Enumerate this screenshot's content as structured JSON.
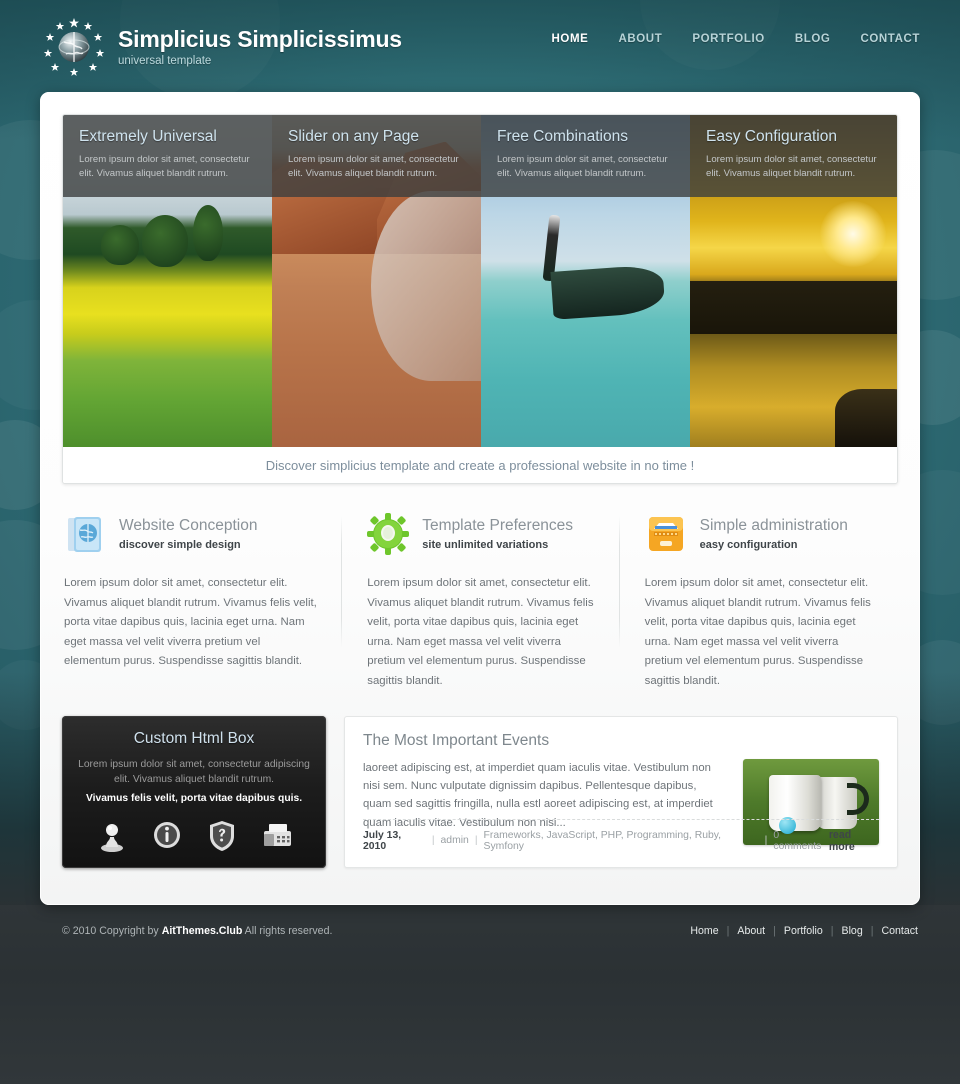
{
  "header": {
    "brand_title": "Simplicius Simplicissimus",
    "brand_subtitle": "universal template",
    "logo_icon": "globe-stars-icon",
    "nav": [
      {
        "label": "HOME",
        "active": true
      },
      {
        "label": "ABOUT",
        "active": false
      },
      {
        "label": "PORTFOLIO",
        "active": false
      },
      {
        "label": "BLOG",
        "active": false
      },
      {
        "label": "CONTACT",
        "active": false
      }
    ]
  },
  "slider": {
    "slides": [
      {
        "title": "Extremely Universal",
        "text": "Lorem ipsum dolor sit amet, consectetur elit. Vivamus aliquet blandit rutrum.",
        "image": "green-rapeseed-field-with-trees"
      },
      {
        "title": "Slider on any Page",
        "text": "Lorem ipsum dolor sit amet, consectetur elit. Vivamus aliquet blandit rutrum.",
        "image": "red-sandstone-cliff-beach"
      },
      {
        "title": "Free Combinations",
        "text": "Lorem ipsum dolor sit amet, consectetur elit. Vivamus aliquet blandit rutrum.",
        "image": "longtail-boat-turquoise-sea"
      },
      {
        "title": "Easy Configuration",
        "text": "Lorem ipsum dolor sit amet, consectetur elit. Vivamus aliquet blandit rutrum.",
        "image": "golden-sunset-over-water"
      }
    ],
    "tagline": "Discover simplicius template and create a professional website in no time !"
  },
  "features": [
    {
      "icon": "blue-book-globe-icon",
      "title": "Website Conception",
      "subtitle": "discover simple design",
      "body": "Lorem ipsum dolor sit amet, consectetur elit. Vivamus aliquet blandit rutrum. Vivamus felis velit, porta vitae dapibus quis, lacinia eget urna. Nam eget massa vel velit viverra pretium vel elementum purus. Suspendisse sagittis blandit."
    },
    {
      "icon": "green-gear-icon",
      "title": "Template Preferences",
      "subtitle": "site unlimited variations",
      "body": "Lorem ipsum dolor sit amet, consectetur elit. Vivamus aliquet blandit rutrum. Vivamus felis velit, porta vitae dapibus quis, lacinia eget urna. Nam eget massa vel velit viverra pretium vel elementum purus. Suspendisse sagittis blandit."
    },
    {
      "icon": "orange-filebox-icon",
      "title": "Simple administration",
      "subtitle": "easy configuration",
      "body": "Lorem ipsum dolor sit amet, consectetur elit. Vivamus aliquet blandit rutrum. Vivamus felis velit, porta vitae dapibus quis, lacinia eget urna. Nam eget massa vel velit viverra pretium vel elementum purus. Suspendisse sagittis blandit."
    }
  ],
  "html_box": {
    "title": "Custom Html Box",
    "text": "Lorem ipsum dolor sit amet, consectetur adipiscing elit. Vivamus aliquet blandit rutrum.",
    "text_strong": "Vivamus felis velit, porta vitae dapibus quis.",
    "icons": [
      "user-chess-pawn-icon",
      "info-circle-icon",
      "shield-question-icon",
      "fax-machine-icon"
    ]
  },
  "events": {
    "title": "The Most Important Events",
    "body": "laoreet adipiscing est, at imperdiet quam iaculis vitae. Vestibulum non nisi sem. Nunc vulputate dignissim dapibus. Pellentesque dapibus, quam sed sagittis fringilla, nulla estl aoreet adipiscing est, at imperdiet quam iaculis vitae. Vestibulum non nisi...",
    "thumb_image": "coffee-mugs-in-grass",
    "meta": {
      "date": "July 13, 2010",
      "author": "admin",
      "categories": "Frameworks, JavaScript, PHP, Programming, Ruby, Symfony",
      "comments": "0 comments",
      "separator": "|"
    },
    "read_more": "read more"
  },
  "footer": {
    "copyright_prefix": "© 2010 Copyright by ",
    "copyright_brand": "AitThemes.Club",
    "copyright_suffix": " All rights reserved.",
    "links": [
      "Home",
      "About",
      "Portfolio",
      "Blog",
      "Contact"
    ],
    "separator": "|"
  },
  "colors": {
    "background_teal": "#2e6d76",
    "footer_dark": "#2b3134",
    "panel_white": "#ffffff",
    "heading_grey": "#8a9298",
    "slide_title": "#cfe3ee"
  }
}
